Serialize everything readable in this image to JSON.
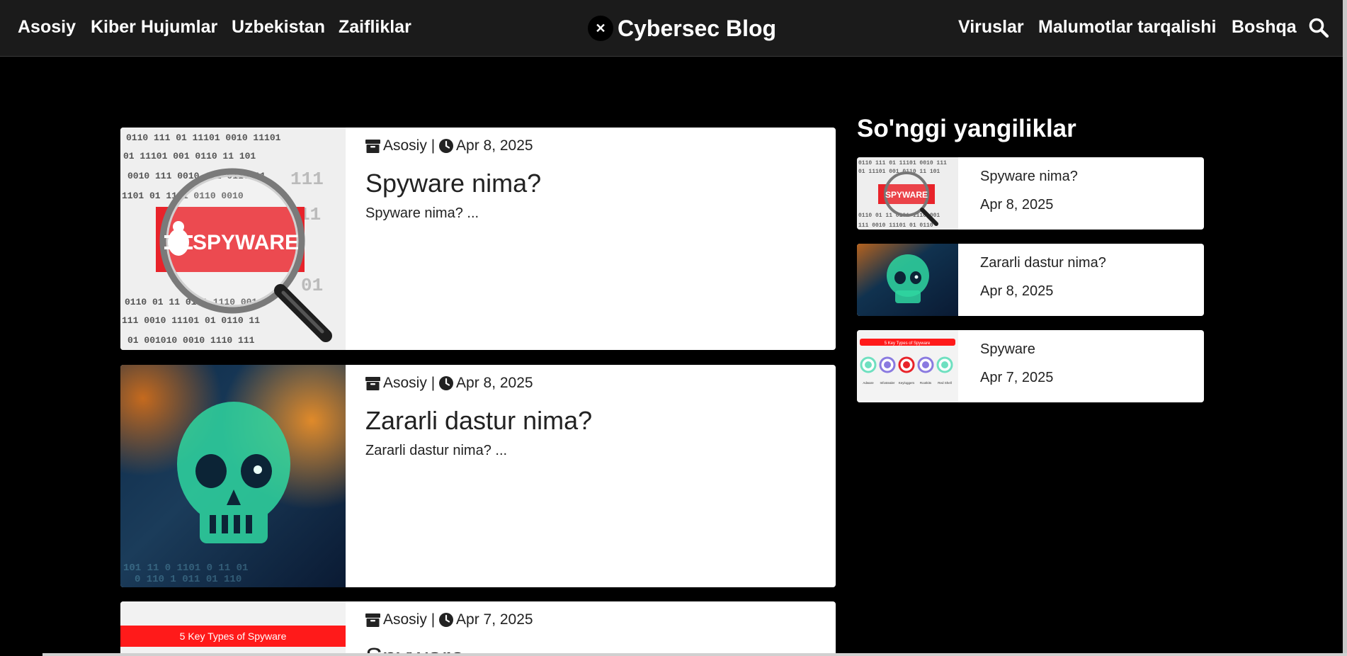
{
  "nav": {
    "left": [
      "Asosiy",
      "Kiber Hujumlar",
      "Uzbekistan",
      "Zaifliklar"
    ],
    "right": [
      "Viruslar",
      "Malumotlar tarqalishi",
      "Boshqa"
    ],
    "brand": "Cybersec Blog",
    "brand_icon": "x-logo-icon",
    "search_icon": "search-icon"
  },
  "posts": [
    {
      "category": "Asosiy",
      "separator": "|",
      "date": "Apr 8, 2025",
      "title": "Spyware nima?",
      "excerpt": "Spyware nima? ...",
      "image_text": "SPYWARE"
    },
    {
      "category": "Asosiy",
      "separator": "|",
      "date": "Apr 8, 2025",
      "title": "Zararli dastur nima?",
      "excerpt": "Zararli dastur nima? ...",
      "image_text": ""
    },
    {
      "category": "Asosiy",
      "separator": "|",
      "date": "Apr 7, 2025",
      "title": "Spyware",
      "excerpt": "",
      "image_text": "5 Key Types of Spyware"
    }
  ],
  "sidebar": {
    "heading": "So'nggi yangiliklar",
    "items": [
      {
        "title": "Spyware nima?",
        "date": "Apr 8, 2025",
        "image_text": "SPYWARE"
      },
      {
        "title": "Zararli dastur nima?",
        "date": "Apr 8, 2025"
      },
      {
        "title": "Spyware",
        "date": "Apr 7, 2025",
        "image_text": "5 Key Types of Spyware",
        "image_labels": [
          "Adware",
          "Infostealer",
          "Keyloggers",
          "Rootkits",
          "Red Shell"
        ]
      }
    ]
  },
  "colors": {
    "nav_bg": "#1b1b1b",
    "page_bg": "#000000",
    "card_bg": "#ffffff",
    "accent_red": "#e8232a",
    "malware_green": "#2fd6a0"
  }
}
